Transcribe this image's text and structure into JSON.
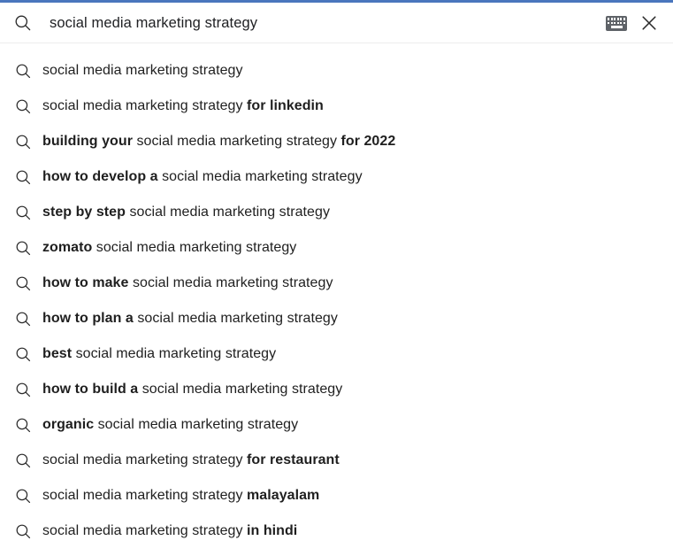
{
  "theme": {
    "top_accent_color": "#4a76bd",
    "background_color": "#ffffff",
    "text_color": "#1f1f1f",
    "query_text_color": "#202124",
    "divider_color": "#ededed",
    "icon_color": "#2b2b2b",
    "keyboard_icon_color": "#5f6368"
  },
  "searchbar": {
    "search_icon_name": "search-icon",
    "query": "social media marketing strategy",
    "placeholder": "Search",
    "keyboard_icon_name": "keyboard-icon",
    "keyboard_icon_label": "Search by voice keyboard",
    "close_icon_name": "close-icon",
    "close_icon_label": "Clear search"
  },
  "suggestions": {
    "row_icon_name": "search-icon",
    "items": [
      {
        "parts": [
          {
            "text": "social media marketing strategy",
            "bold": false
          }
        ]
      },
      {
        "parts": [
          {
            "text": "social media marketing strategy ",
            "bold": false
          },
          {
            "text": "for linkedin",
            "bold": true
          }
        ]
      },
      {
        "parts": [
          {
            "text": "building your",
            "bold": true
          },
          {
            "text": " social media marketing strategy ",
            "bold": false
          },
          {
            "text": "for 2022",
            "bold": true
          }
        ]
      },
      {
        "parts": [
          {
            "text": "how to develop a",
            "bold": true
          },
          {
            "text": " social media marketing strategy",
            "bold": false
          }
        ]
      },
      {
        "parts": [
          {
            "text": "step by step",
            "bold": true
          },
          {
            "text": " social media marketing strategy",
            "bold": false
          }
        ]
      },
      {
        "parts": [
          {
            "text": "zomato",
            "bold": true
          },
          {
            "text": " social media marketing strategy",
            "bold": false
          }
        ]
      },
      {
        "parts": [
          {
            "text": "how to make",
            "bold": true
          },
          {
            "text": " social media marketing strategy",
            "bold": false
          }
        ]
      },
      {
        "parts": [
          {
            "text": "how to plan a",
            "bold": true
          },
          {
            "text": " social media marketing strategy",
            "bold": false
          }
        ]
      },
      {
        "parts": [
          {
            "text": "best",
            "bold": true
          },
          {
            "text": " social media marketing strategy",
            "bold": false
          }
        ]
      },
      {
        "parts": [
          {
            "text": "how to build a",
            "bold": true
          },
          {
            "text": " social media marketing strategy",
            "bold": false
          }
        ]
      },
      {
        "parts": [
          {
            "text": "organic",
            "bold": true
          },
          {
            "text": " social media marketing strategy",
            "bold": false
          }
        ]
      },
      {
        "parts": [
          {
            "text": "social media marketing strategy ",
            "bold": false
          },
          {
            "text": "for restaurant",
            "bold": true
          }
        ]
      },
      {
        "parts": [
          {
            "text": "social media marketing strategy ",
            "bold": false
          },
          {
            "text": "malayalam",
            "bold": true
          }
        ]
      },
      {
        "parts": [
          {
            "text": "social media marketing strategy ",
            "bold": false
          },
          {
            "text": "in hindi",
            "bold": true
          }
        ]
      }
    ]
  }
}
